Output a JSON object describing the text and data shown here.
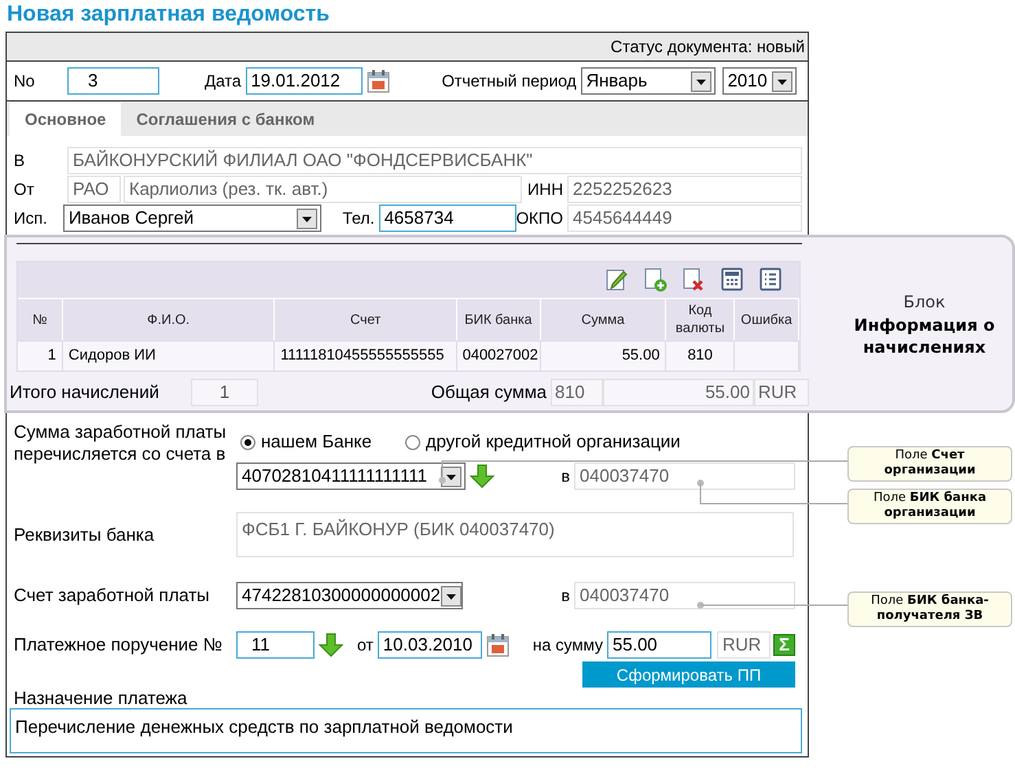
{
  "title": "Новая зарплатная ведомость",
  "status": "Статус документа: новый",
  "header": {
    "number_label": "No",
    "number": "3",
    "date_label": "Дата",
    "date": "19.01.2012",
    "period_label": "Отчетный период",
    "month": "Январь",
    "year": "2010"
  },
  "tabs": [
    {
      "label": "Основное",
      "selected": true
    },
    {
      "label": "Соглашения с банком",
      "selected": false
    }
  ],
  "parties": {
    "to_label": "В",
    "to": "БАЙКОНУРСКИЙ ФИЛИАЛ ОАО \"ФОНДСЕРВИСБАНК\"",
    "from_label": "От",
    "from_code": "РАО",
    "from_name": "Карлиолиз (рез. тк. авт.)",
    "inn_label": "ИНН",
    "inn": "2252252623",
    "executor_label": "Исп.",
    "executor": "Иванов Сергей",
    "phone_label": "Тел.",
    "phone": "4658734",
    "okpo_label": "ОКПО",
    "okpo": "4545644449"
  },
  "accruals": {
    "columns": [
      "№",
      "Ф.И.О.",
      "Счет",
      "БИК банка",
      "Сумма",
      "Код валюты",
      "Ошибка"
    ],
    "rows": [
      [
        "1",
        "Сидоров ИИ",
        "11111810455555555555",
        "040027002",
        "55.00",
        "810"
      ]
    ],
    "count_label": "Итого начислений",
    "count": "1",
    "total_label": "Общая сумма",
    "currency_code": "810",
    "total": "55.00",
    "currency": "RUR"
  },
  "block_note": {
    "caption": "Блок",
    "title": "Информация о начислениях"
  },
  "payment": {
    "source_label": "Сумма заработной платы перечисляется со счета в",
    "source_options": [
      {
        "label": "нашем Банке",
        "selected": true
      },
      {
        "label": "другой кредитной организации",
        "selected": false
      }
    ],
    "org_account": "40702810411111111111",
    "org_bik_label": "в",
    "org_bik": "040037470",
    "bank_details_label": "Реквизиты банка",
    "bank_details": "ФСБ1 Г. БАЙКОНУР (БИК 040037470)",
    "salary_account_label": "Счет заработной платы",
    "salary_account": "47422810300000000002",
    "salary_bik_label": "в",
    "salary_bik": "040037470",
    "order_label": "Платежное поручение №",
    "order_number": "11",
    "order_date_label": "от",
    "order_date": "10.03.2010",
    "amount_label": "на сумму",
    "amount": "55.00",
    "amount_currency": "RUR",
    "sum_button": "Σ",
    "create_button": "Сформировать ПП",
    "purpose_label": "Назначение платежа",
    "purpose": "Перечисление денежных средств по зарплатной ведомости"
  },
  "callouts": [
    "Поле **Счет организации**",
    "Поле **БИК банка организации**",
    "Поле **БИК банка-получателя ЗВ**"
  ]
}
